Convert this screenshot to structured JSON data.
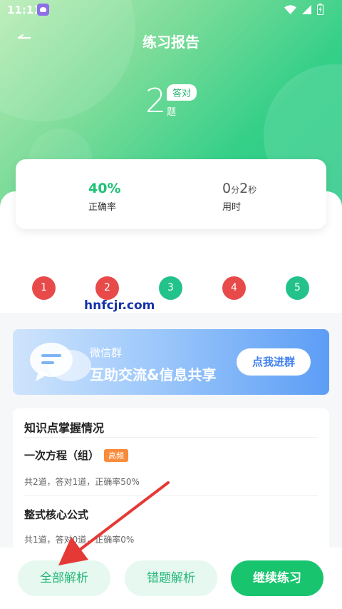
{
  "status_bar": {
    "time": "11:11"
  },
  "header": {
    "title": "练习报告"
  },
  "score": {
    "count": "2",
    "unit": "题",
    "badge": "答对"
  },
  "stats": {
    "accuracy_value": "40%",
    "accuracy_label": "正确率",
    "time_min": "0",
    "time_min_unit": "分",
    "time_sec": "2",
    "time_sec_unit": "秒",
    "time_label": "用时"
  },
  "questions": [
    {
      "num": "1",
      "status": "wrong"
    },
    {
      "num": "2",
      "status": "wrong"
    },
    {
      "num": "3",
      "status": "right"
    },
    {
      "num": "4",
      "status": "wrong"
    },
    {
      "num": "5",
      "status": "right"
    }
  ],
  "watermark": "hnfcjr.com",
  "banner": {
    "line1": "微信群",
    "line2": "互助交流&信息共享",
    "button": "点我进群"
  },
  "knowledge": {
    "title": "知识点掌握情况",
    "items": [
      {
        "name": "一次方程（组）",
        "tag": "高频",
        "desc": "共2道，答对1道，正确率50%"
      },
      {
        "name": "整式核心公式",
        "desc": "共1道，答对0道，正确率0%"
      }
    ]
  },
  "bottom": {
    "all_analysis": "全部解析",
    "wrong_analysis": "错题解析",
    "continue": "继续练习"
  },
  "colors": {
    "accent": "#18c46e",
    "wrong": "#e84a4a",
    "right": "#23c28b",
    "banner_blue": "#5c9df5"
  }
}
